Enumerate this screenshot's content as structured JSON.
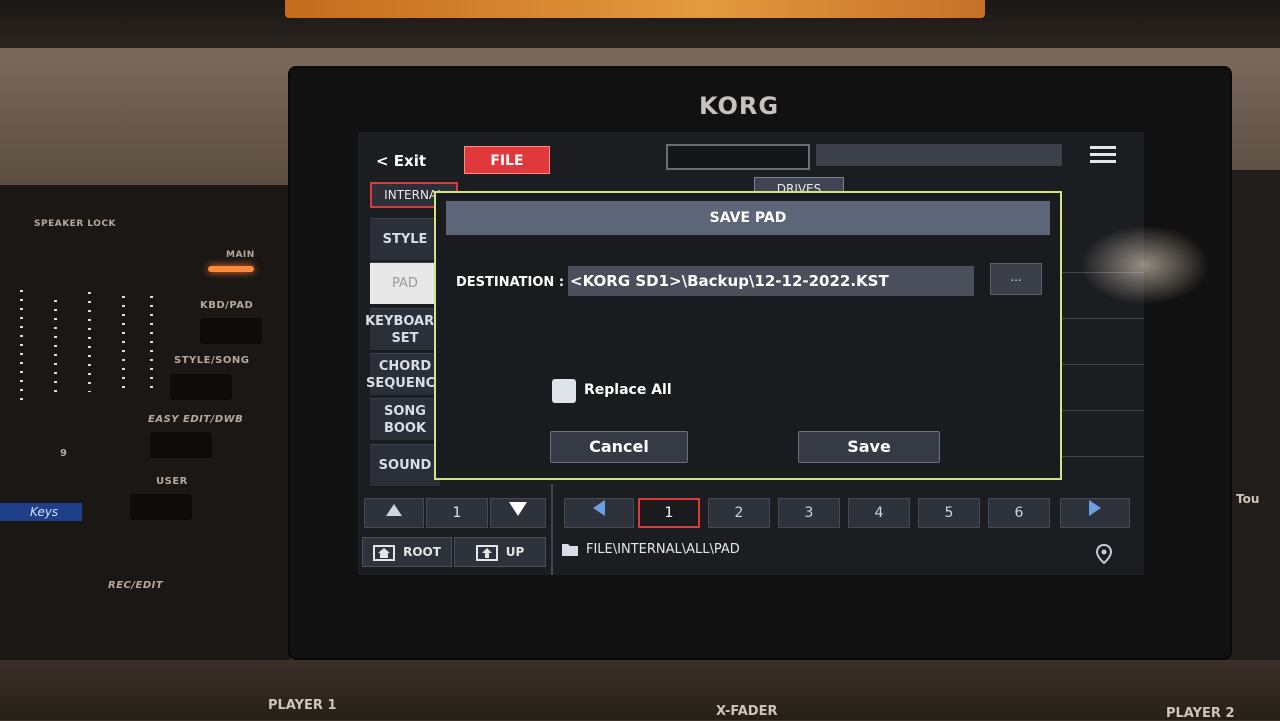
{
  "hardware": {
    "brand": "KORG",
    "speaker_lock": "SPEAKER LOCK",
    "main": "MAIN",
    "kbd_pad": "KBD/PAD",
    "style_song": "STYLE/SONG",
    "easy_edit": "EASY EDIT/DWB",
    "user": "USER",
    "rec_edit": "REC/EDIT",
    "number_9": "9",
    "keys_display": "Keys",
    "player1": "PLAYER 1",
    "xfader": "X-FADER",
    "player2": "PLAYER 2",
    "touch": "Tou"
  },
  "header": {
    "exit_label": "< Exit",
    "file_tab": "FILE"
  },
  "tabs": {
    "internal": "INTERNAL",
    "drives": "DRIVES"
  },
  "sidebar": {
    "items": [
      {
        "label": "STYLE"
      },
      {
        "label": "PAD"
      },
      {
        "label": "KEYBOARD SET"
      },
      {
        "label": "CHORD SEQUENCE"
      },
      {
        "label": "SONG BOOK"
      },
      {
        "label": "SOUND"
      }
    ]
  },
  "nav": {
    "page_number": "1",
    "pages": [
      "1",
      "2",
      "3",
      "4",
      "5",
      "6"
    ],
    "current_page": "1",
    "root_label": "ROOT",
    "up_label": "UP",
    "path": "FILE\\INTERNAL\\ALL\\PAD"
  },
  "dialog": {
    "title": "SAVE PAD",
    "destination_label": "DESTINATION :",
    "destination_value": "<KORG SD1>\\Backup\\12-12-2022.KST",
    "browse_label": "...",
    "replace_all_label": "Replace All",
    "cancel_label": "Cancel",
    "save_label": "Save"
  },
  "colors": {
    "accent_red": "#e0393b",
    "dialog_border": "#d4e37a",
    "title_bar": "#5d6678"
  }
}
